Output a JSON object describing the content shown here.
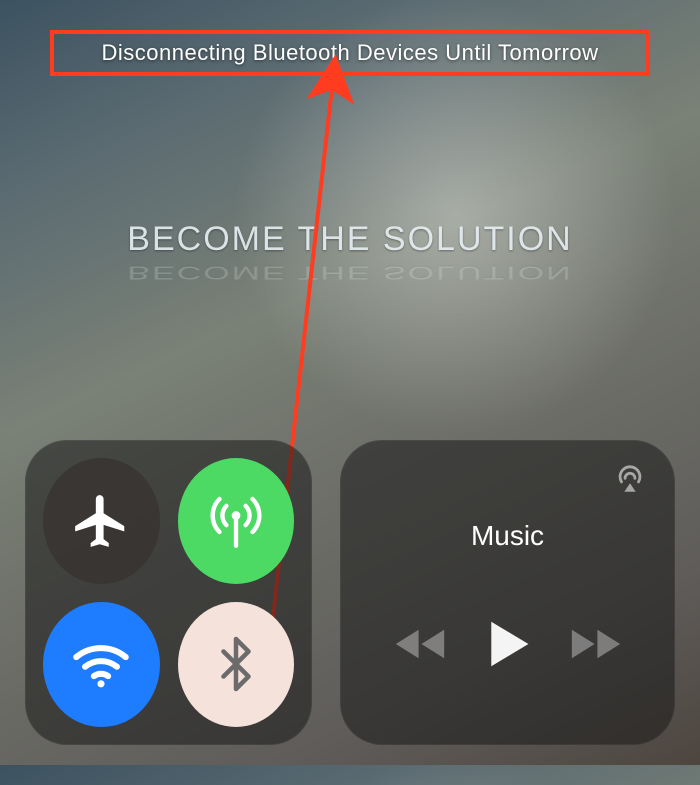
{
  "toast": {
    "message": "Disconnecting Bluetooth Devices Until Tomorrow"
  },
  "watermark": {
    "text": "BECOME THE SOLUTION"
  },
  "connectivity": {
    "airplane": {
      "icon": "airplane-icon",
      "active": false
    },
    "cellular": {
      "icon": "cellular-antenna-icon",
      "active": true,
      "color": "#4cd964"
    },
    "wifi": {
      "icon": "wifi-icon",
      "active": true,
      "color": "#1e7cff"
    },
    "bluetooth": {
      "icon": "bluetooth-icon",
      "active": false,
      "color": "#f5e2da"
    }
  },
  "music": {
    "title": "Music",
    "airplay_icon": "airplay-icon",
    "prev_icon": "previous-track-icon",
    "play_icon": "play-icon",
    "next_icon": "next-track-icon"
  },
  "annotation": {
    "highlight_color": "#ff3b20"
  }
}
